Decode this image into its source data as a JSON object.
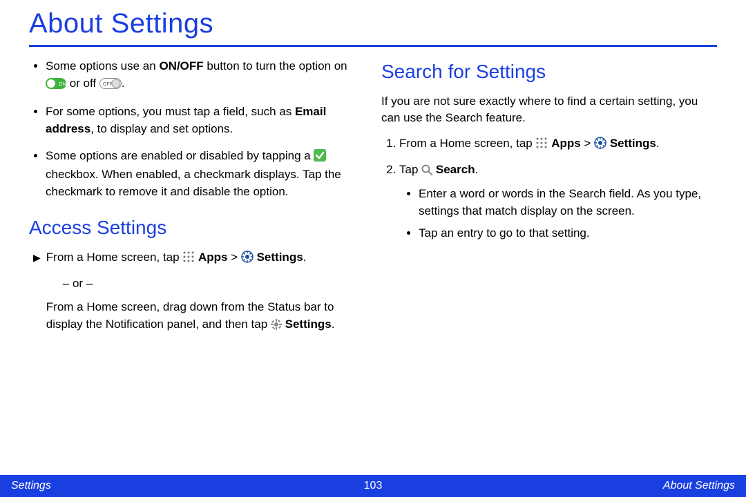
{
  "title": "About Settings",
  "left": {
    "bullets": [
      {
        "pre": "Some options use an ",
        "bold1": "ON/OFF",
        "mid": " button to turn the option on ",
        "mid2": " or off ",
        "end": "."
      },
      {
        "pre": "For some options, you must tap a field, such as ",
        "bold1": "Email address",
        "end": ", to display and set options."
      },
      {
        "pre": "Some options are enabled or disabled by tapping a ",
        "post": " checkbox. When enabled, a checkmark displays. Tap the checkmark to remove it and disable the option."
      }
    ],
    "heading": "Access Settings",
    "arrow": {
      "pre": "From a Home screen, tap ",
      "apps": "Apps",
      "sep": " > ",
      "settings": "Settings",
      "end": "."
    },
    "or": "– or –",
    "para2_pre": "From a Home screen, drag down from the Status bar to display the Notification panel, and then tap ",
    "para2_bold": "Settings",
    "para2_end": "."
  },
  "right": {
    "heading": "Search for Settings",
    "intro": "If you are not sure exactly where to find a certain setting, you can use the Search feature.",
    "step1": {
      "pre": "From a Home screen, tap ",
      "apps": "Apps",
      "sep": " > ",
      "settings": "Settings",
      "end": "."
    },
    "step2": {
      "pre": "Tap ",
      "bold": "Search",
      "end": "."
    },
    "sub": [
      "Enter a word or words in the Search field. As you type, settings that match display on the screen.",
      "Tap an entry to go to that setting."
    ]
  },
  "footer": {
    "left": "Settings",
    "center": "103",
    "right": "About Settings"
  }
}
